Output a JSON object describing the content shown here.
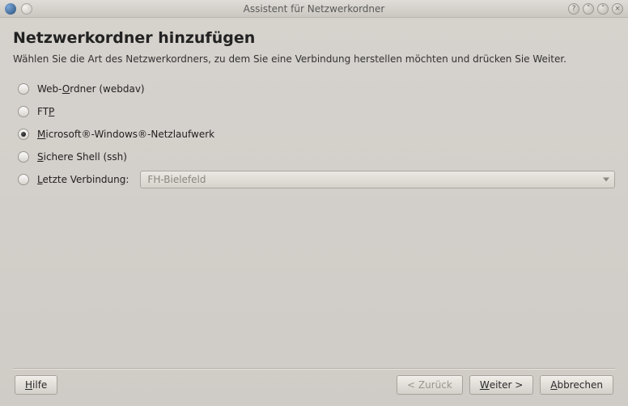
{
  "window": {
    "title": "Assistent für Netzwerkordner"
  },
  "page": {
    "heading": "Netzwerkordner hinzufügen",
    "subtitle": "Wählen Sie die Art des Netzwerkordners, zu dem Sie eine Verbindung herstellen möchten und drücken Sie Weiter."
  },
  "options": {
    "webdav": {
      "pre": "Web-",
      "accel": "O",
      "post": "rdner (webdav)",
      "checked": false
    },
    "ftp": {
      "pre": "FT",
      "accel": "P",
      "post": "",
      "checked": false
    },
    "smb": {
      "pre": "",
      "accel": "M",
      "post": "icrosoft®-Windows®-Netzlaufwerk",
      "checked": true
    },
    "ssh": {
      "pre": "",
      "accel": "S",
      "post": "ichere Shell (ssh)",
      "checked": false
    },
    "recent": {
      "pre": "",
      "accel": "L",
      "post": "etzte Verbindung:",
      "checked": false,
      "value": "FH-Bielefeld"
    }
  },
  "buttons": {
    "help": {
      "accel": "H",
      "post": "ilfe"
    },
    "back": {
      "text": "< Zurück"
    },
    "next": {
      "accel": "W",
      "post": "eiter >"
    },
    "cancel": {
      "accel": "A",
      "post": "bbrechen"
    }
  }
}
